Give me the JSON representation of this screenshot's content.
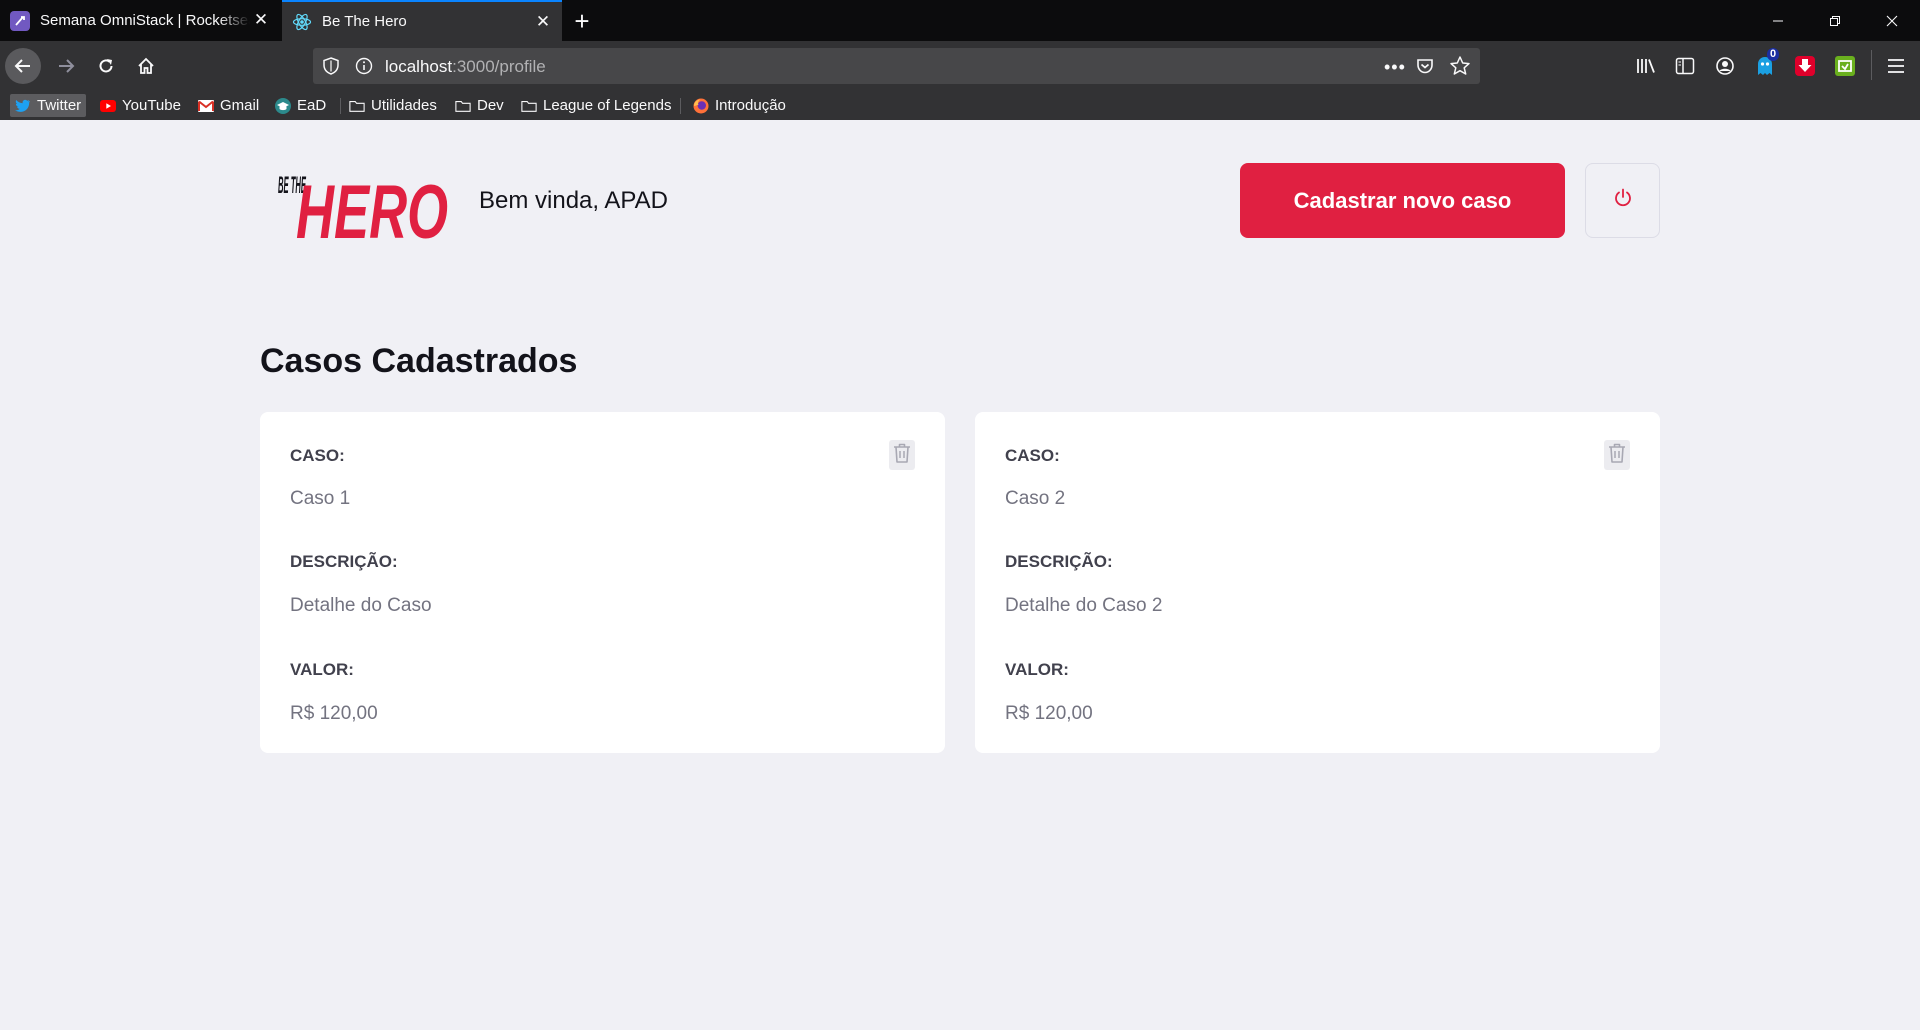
{
  "browser": {
    "tabs": [
      {
        "title": "Semana OmniStack | Rocketseat",
        "active": false
      },
      {
        "title": "Be The Hero",
        "active": true
      }
    ],
    "url": {
      "host": "localhost",
      "rest": ":3000/profile"
    },
    "bookmarks": [
      {
        "label": "Twitter",
        "icon": "twitter-icon"
      },
      {
        "label": "YouTube",
        "icon": "youtube-icon"
      },
      {
        "label": "Gmail",
        "icon": "gmail-icon"
      },
      {
        "label": "EaD",
        "icon": "graduation-cap-icon"
      },
      {
        "label": "Utilidades",
        "icon": "folder-icon"
      },
      {
        "label": "Dev",
        "icon": "folder-icon"
      },
      {
        "label": "League of Legends",
        "icon": "folder-icon"
      },
      {
        "label": "Introdução",
        "icon": "firefox-icon"
      }
    ],
    "notification_badge": "0"
  },
  "header": {
    "logo_top": "BE THE",
    "logo_main": "HERO",
    "welcome": "Bem vinda, APAD",
    "new_case_button": "Cadastrar novo caso"
  },
  "main": {
    "title": "Casos Cadastrados",
    "labels": {
      "case": "CASO:",
      "description": "DESCRIÇÃO:",
      "value": "VALOR:"
    },
    "cases": [
      {
        "title": "Caso 1",
        "description": "Detalhe do Caso",
        "value": "R$ 120,00"
      },
      {
        "title": "Caso 2",
        "description": "Detalhe do Caso 2",
        "value": "R$ 120,00"
      }
    ]
  },
  "colors": {
    "brand": "#e02041",
    "background": "#f0f0f5",
    "card": "#ffffff"
  }
}
